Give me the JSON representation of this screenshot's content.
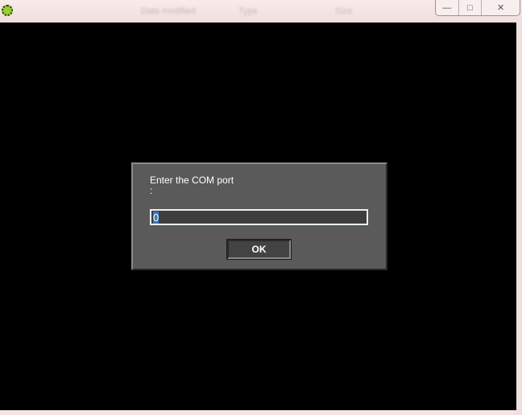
{
  "titlebar": {
    "background_columns": [
      "Date modified",
      "Type",
      "Size"
    ],
    "controls": {
      "minimize": "—",
      "maximize": "□",
      "close": "✕"
    }
  },
  "dialog": {
    "prompt": "Enter the COM port\n:",
    "input_value": "0",
    "ok_label": "OK"
  }
}
